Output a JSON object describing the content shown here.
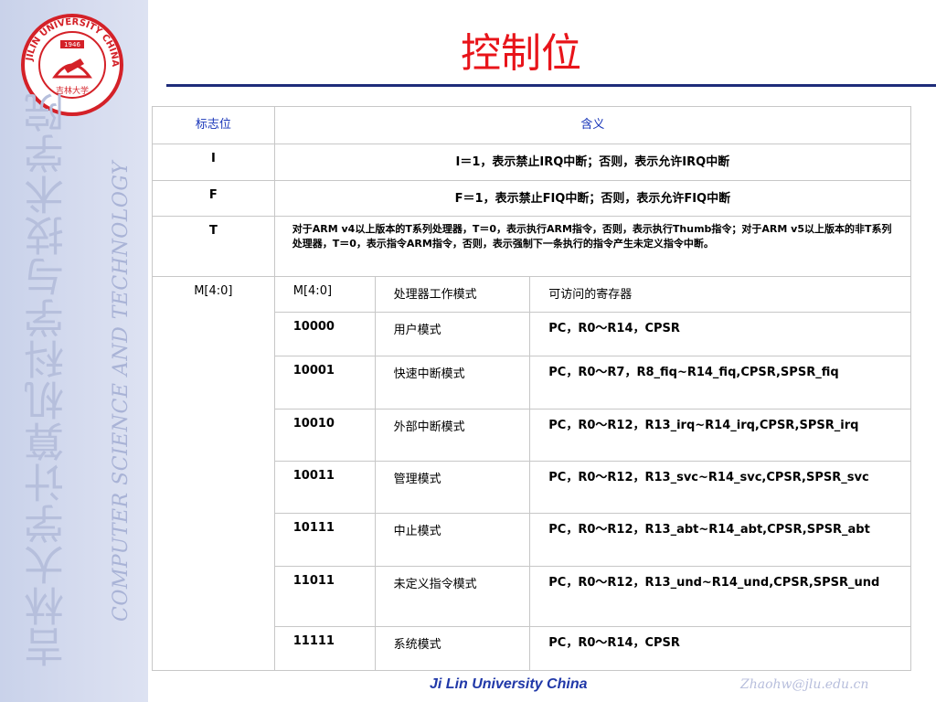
{
  "slide": {
    "title": "控制位",
    "footer_center": "Ji Lin University China",
    "footer_right": "Zhaohw@jlu.edu.cn"
  },
  "sidebar": {
    "logo": {
      "ring_text": "JILIN UNIVERSITY CHINA",
      "year": "1946",
      "seal_text": "吉林大学",
      "icon": "university-seal-icon"
    },
    "vertical_cn": "吉林大学计算机科学与技术学院",
    "vertical_en": "COMPUTER SCIENCE AND TECHNOLOGY"
  },
  "table": {
    "header": {
      "flag": "标志位",
      "meaning": "含义"
    },
    "rows": [
      {
        "flag": "I",
        "meaning": "I＝1，表示禁止IRQ中断；否则，表示允许IRQ中断"
      },
      {
        "flag": "F",
        "meaning": "F＝1，表示禁止FIQ中断；否则，表示允许FIQ中断"
      },
      {
        "flag": "T",
        "meaning": "对于ARM v4以上版本的T系列处理器，T＝0，表示执行ARM指令，否则，表示执行Thumb指令；对于ARM v5以上版本的非T系列处理器，T＝0，表示指令ARM指令，否则，表示强制下一条执行的指令产生未定义指令中断。"
      }
    ],
    "mode_flag": "M[4:0]",
    "mode_header": {
      "bits": "M[4:0]",
      "mode": "处理器工作模式",
      "regs": "可访问的寄存器"
    },
    "modes": [
      {
        "bits": "10000",
        "mode": "用户模式",
        "regs": "PC，R0～R14，CPSR"
      },
      {
        "bits": "10001",
        "mode": "快速中断模式",
        "regs": "PC，R0～R7，R8_fiq~R14_fiq,CPSR,SPSR_fiq"
      },
      {
        "bits": "10010",
        "mode": "外部中断模式",
        "regs": "PC，R0～R12，R13_irq~R14_irq,CPSR,SPSR_irq"
      },
      {
        "bits": "10011",
        "mode": "管理模式",
        "regs": "PC，R0～R12，R13_svc~R14_svc,CPSR,SPSR_svc"
      },
      {
        "bits": "10111",
        "mode": "中止模式",
        "regs": "PC，R0～R12，R13_abt~R14_abt,CPSR,SPSR_abt"
      },
      {
        "bits": "11011",
        "mode": "未定义指令模式",
        "regs": "PC，R0～R12，R13_und~R14_und,CPSR,SPSR_und"
      },
      {
        "bits": "11111",
        "mode": "系统模式",
        "regs": "PC，R0～R14，CPSR"
      }
    ]
  },
  "colors": {
    "title": "#e8141a",
    "rule": "#1e2c7a",
    "header_text": "#1633b8",
    "sidebar": "#d6dcef"
  }
}
